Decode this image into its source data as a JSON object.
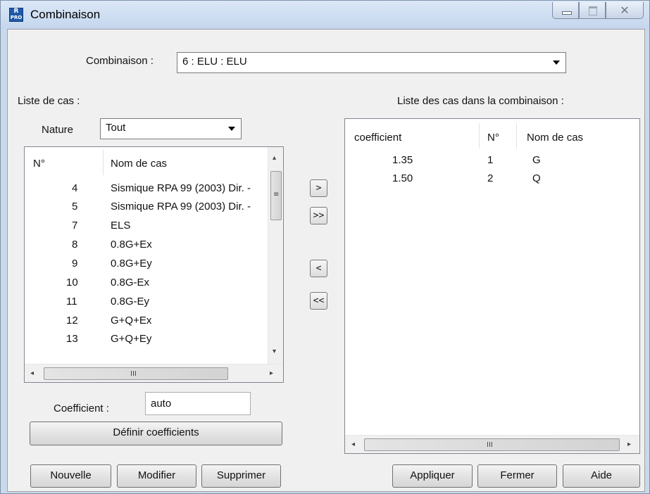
{
  "window": {
    "title": "Combinaison",
    "icon_text_top": "R",
    "icon_text_bottom": "PRO",
    "close_glyph": "✕"
  },
  "combination": {
    "label": "Combinaison :",
    "selected": "6 : ELU : ELU"
  },
  "case_list": {
    "title": "Liste de cas :",
    "nature_label": "Nature",
    "nature_selected": "Tout",
    "columns": [
      "N°",
      "Nom de cas"
    ],
    "rows": [
      {
        "num": "4",
        "name": "Sismique RPA 99 (2003) Dir. -"
      },
      {
        "num": "5",
        "name": "Sismique RPA 99 (2003) Dir. -"
      },
      {
        "num": "7",
        "name": "ELS"
      },
      {
        "num": "8",
        "name": "0.8G+Ex"
      },
      {
        "num": "9",
        "name": "0.8G+Ey"
      },
      {
        "num": "10",
        "name": "0.8G-Ex"
      },
      {
        "num": "11",
        "name": "0.8G-Ey"
      },
      {
        "num": "12",
        "name": "G+Q+Ex"
      },
      {
        "num": "13",
        "name": "G+Q+Ey"
      }
    ],
    "vscroll_grip": "≡",
    "hscroll_grip": "III",
    "scroll_left": "◂",
    "scroll_right": "▸",
    "scroll_up": "▴",
    "scroll_down": "▾"
  },
  "transfer_buttons": {
    "add_one": ">",
    "add_all": ">>",
    "remove_one": "<",
    "remove_all": "<<"
  },
  "combo_list": {
    "title": "Liste des cas dans la combinaison :",
    "columns": [
      "coefficient",
      "N°",
      "Nom de cas"
    ],
    "rows": [
      {
        "coef": "1.35",
        "num": "1",
        "name": "G"
      },
      {
        "coef": "1.50",
        "num": "2",
        "name": "Q"
      }
    ],
    "hscroll_grip": "III"
  },
  "coefficient": {
    "label": "Coefficient :",
    "value": "auto",
    "define_button": "Définir coefficients"
  },
  "buttons": {
    "new": "Nouvelle",
    "modify": "Modifier",
    "delete": "Supprimer",
    "apply": "Appliquer",
    "close": "Fermer",
    "help": "Aide"
  }
}
